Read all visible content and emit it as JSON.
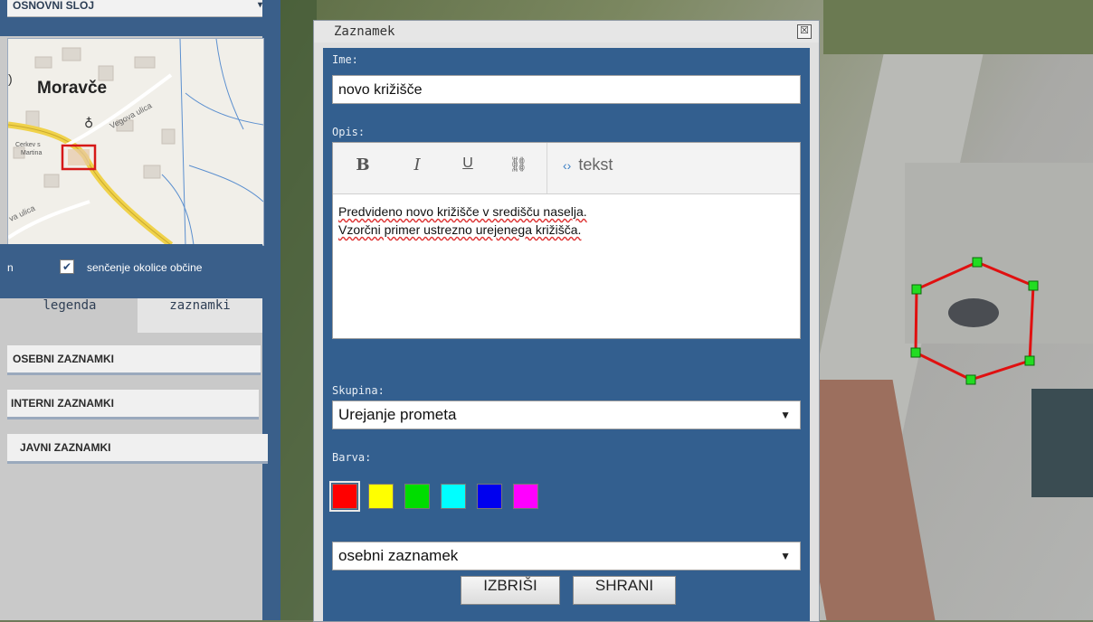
{
  "left_panel": {
    "layer_header": "OSNOVNI SLOJ",
    "minimap": {
      "town_label": "Moravče",
      "street_1": "Vegova ulica",
      "street_2": "va ulica",
      "church_line1": "Cerkev s",
      "church_line2": "Martina"
    },
    "partial_label": "n",
    "shading_checkbox_label": "senčenje okolice občine",
    "shading_checked": true,
    "tabs": [
      "legenda",
      "zaznamki"
    ],
    "note_groups": [
      "OSEBNI ZAZNAMKI",
      "INTERNI ZAZNAMKI",
      "JAVNI ZAZNAMKI"
    ]
  },
  "dialog": {
    "title": "Zaznamek",
    "close_glyph": "☒",
    "name_label": "Ime:",
    "name_value": "novo križišče",
    "description_label": "Opis:",
    "toolbar": {
      "bold": "B",
      "italic": "I",
      "underline": "U",
      "link": "⛓",
      "source_icon": "‹›",
      "source_label": "tekst"
    },
    "description_lines": [
      "Predvideno novo križišče v središču naselja.",
      "Vzorčni primer ustrezno urejenega križišča."
    ],
    "group_label": "Skupina:",
    "group_value": "Urejanje prometa",
    "color_label": "Barva:",
    "colors": [
      "#ff0000",
      "#ffff00",
      "#00dd00",
      "#00ffff",
      "#0000ee",
      "#ff00ff"
    ],
    "selected_color": "#ff0000",
    "note_type_value": "osebni zaznamek",
    "delete_button": "IZBRIŠI",
    "save_button": "SHRANI"
  },
  "map": {
    "polygon_stroke": "#e01010",
    "vertex_fill": "#22dd22"
  }
}
